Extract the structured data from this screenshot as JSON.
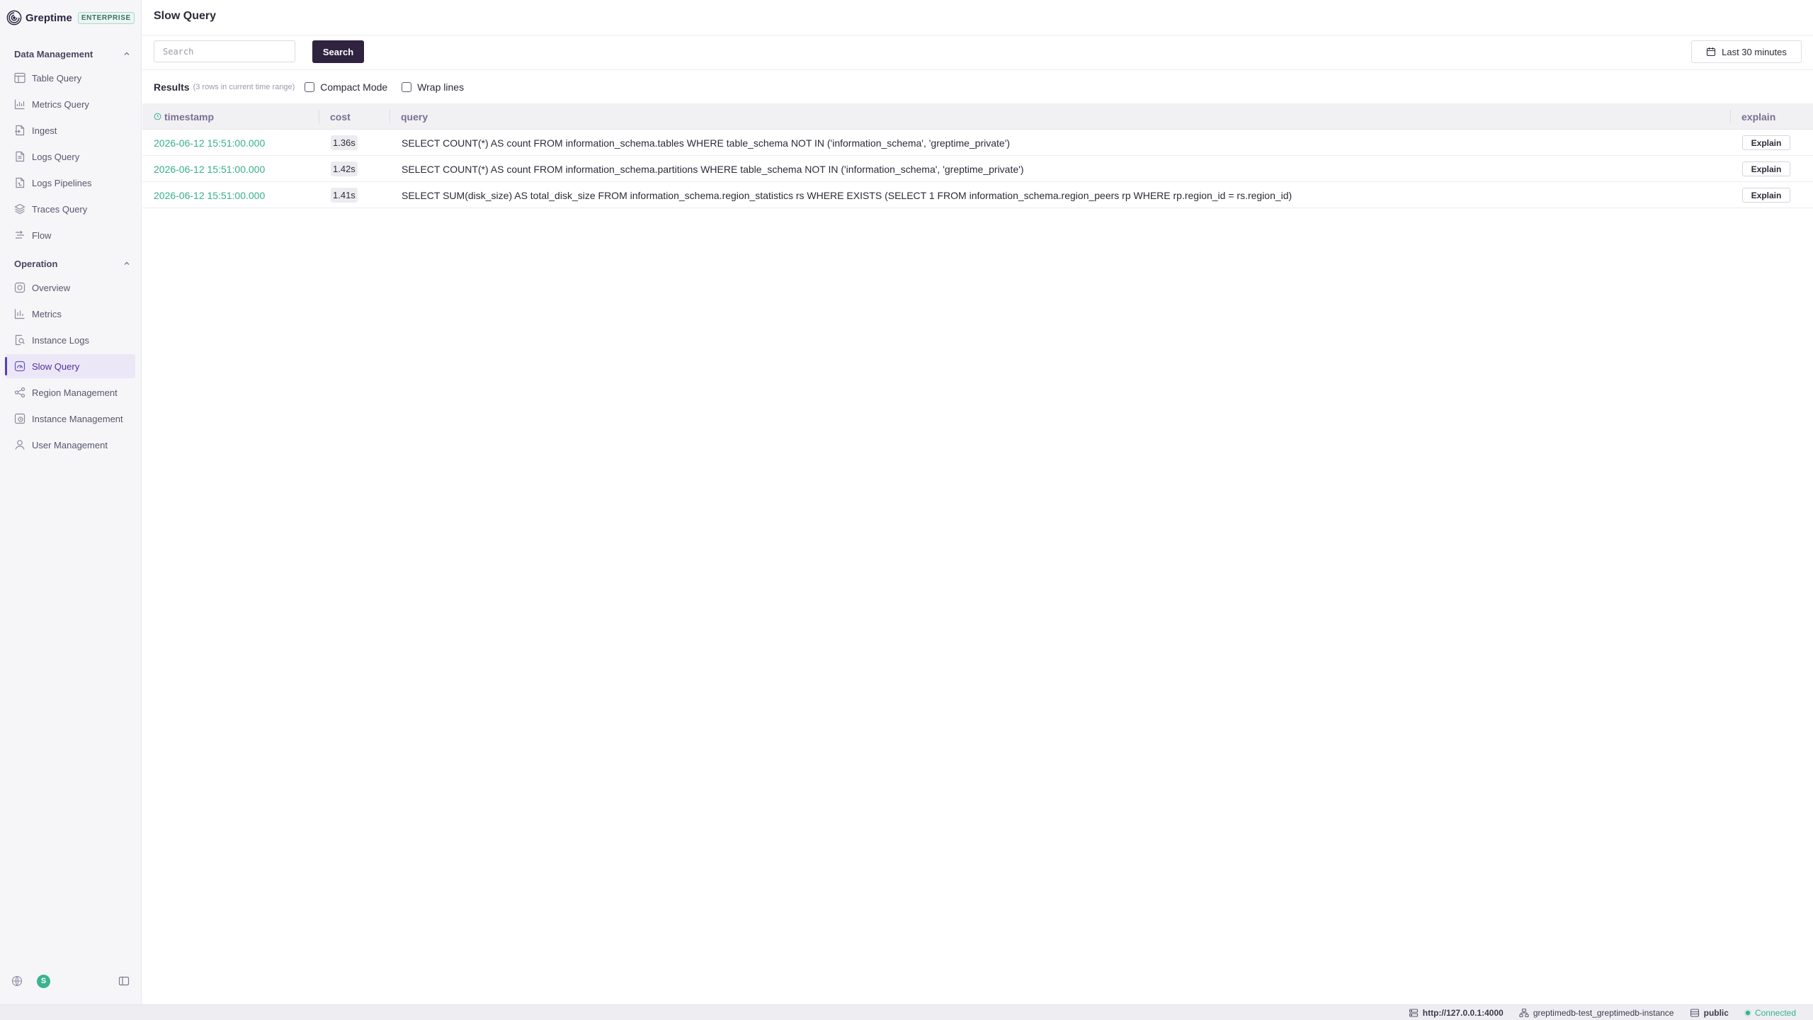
{
  "brand": {
    "name": "Greptime",
    "badge": "ENTERPRISE"
  },
  "sidebar": {
    "sections": [
      {
        "title": "Data Management",
        "items": [
          {
            "label": "Table Query",
            "icon": "table-icon"
          },
          {
            "label": "Metrics Query",
            "icon": "chart-icon"
          },
          {
            "label": "Ingest",
            "icon": "file-import-icon"
          },
          {
            "label": "Logs Query",
            "icon": "file-text-icon"
          },
          {
            "label": "Logs Pipelines",
            "icon": "file-pipeline-icon"
          },
          {
            "label": "Traces Query",
            "icon": "layers-icon"
          },
          {
            "label": "Flow",
            "icon": "flow-icon"
          }
        ]
      },
      {
        "title": "Operation",
        "items": [
          {
            "label": "Overview",
            "icon": "overview-icon"
          },
          {
            "label": "Metrics",
            "icon": "metrics-icon"
          },
          {
            "label": "Instance Logs",
            "icon": "log-search-icon"
          },
          {
            "label": "Slow Query",
            "icon": "gauge-icon",
            "active": true
          },
          {
            "label": "Region Management",
            "icon": "share-icon"
          },
          {
            "label": "Instance Management",
            "icon": "instance-icon"
          },
          {
            "label": "User Management",
            "icon": "user-icon"
          }
        ]
      }
    ],
    "avatar_initial": "S"
  },
  "page": {
    "title": "Slow Query",
    "search_placeholder": "Search",
    "search_button": "Search",
    "time_range": "Last 30 minutes",
    "results_label": "Results",
    "results_note": "(3 rows in current time range)",
    "compact_mode": "Compact Mode",
    "wrap_lines": "Wrap lines"
  },
  "table": {
    "columns": [
      "timestamp",
      "cost",
      "query",
      "explain"
    ],
    "rows": [
      {
        "timestamp": "2026-06-12 15:51:00.000",
        "cost": "1.36s",
        "query": "SELECT COUNT(*) AS count FROM information_schema.tables WHERE table_schema NOT IN ('information_schema', 'greptime_private')",
        "explain": "Explain"
      },
      {
        "timestamp": "2026-06-12 15:51:00.000",
        "cost": "1.42s",
        "query": "SELECT COUNT(*) AS count FROM information_schema.partitions WHERE table_schema NOT IN ('information_schema', 'greptime_private')",
        "explain": "Explain"
      },
      {
        "timestamp": "2026-06-12 15:51:00.000",
        "cost": "1.41s",
        "query": "SELECT SUM(disk_size) AS total_disk_size FROM information_schema.region_statistics rs WHERE EXISTS (SELECT 1 FROM information_schema.region_peers rp WHERE rp.region_id = rs.region_id)",
        "explain": "Explain"
      }
    ]
  },
  "statusbar": {
    "url": "http://127.0.0.1:4000",
    "instance": "greptimedb-test_greptimedb-instance",
    "database": "public",
    "status": "Connected"
  },
  "colors": {
    "accent": "#5b3cc4",
    "primary_button": "#2f2340",
    "timestamp_green": "#36b08a"
  }
}
